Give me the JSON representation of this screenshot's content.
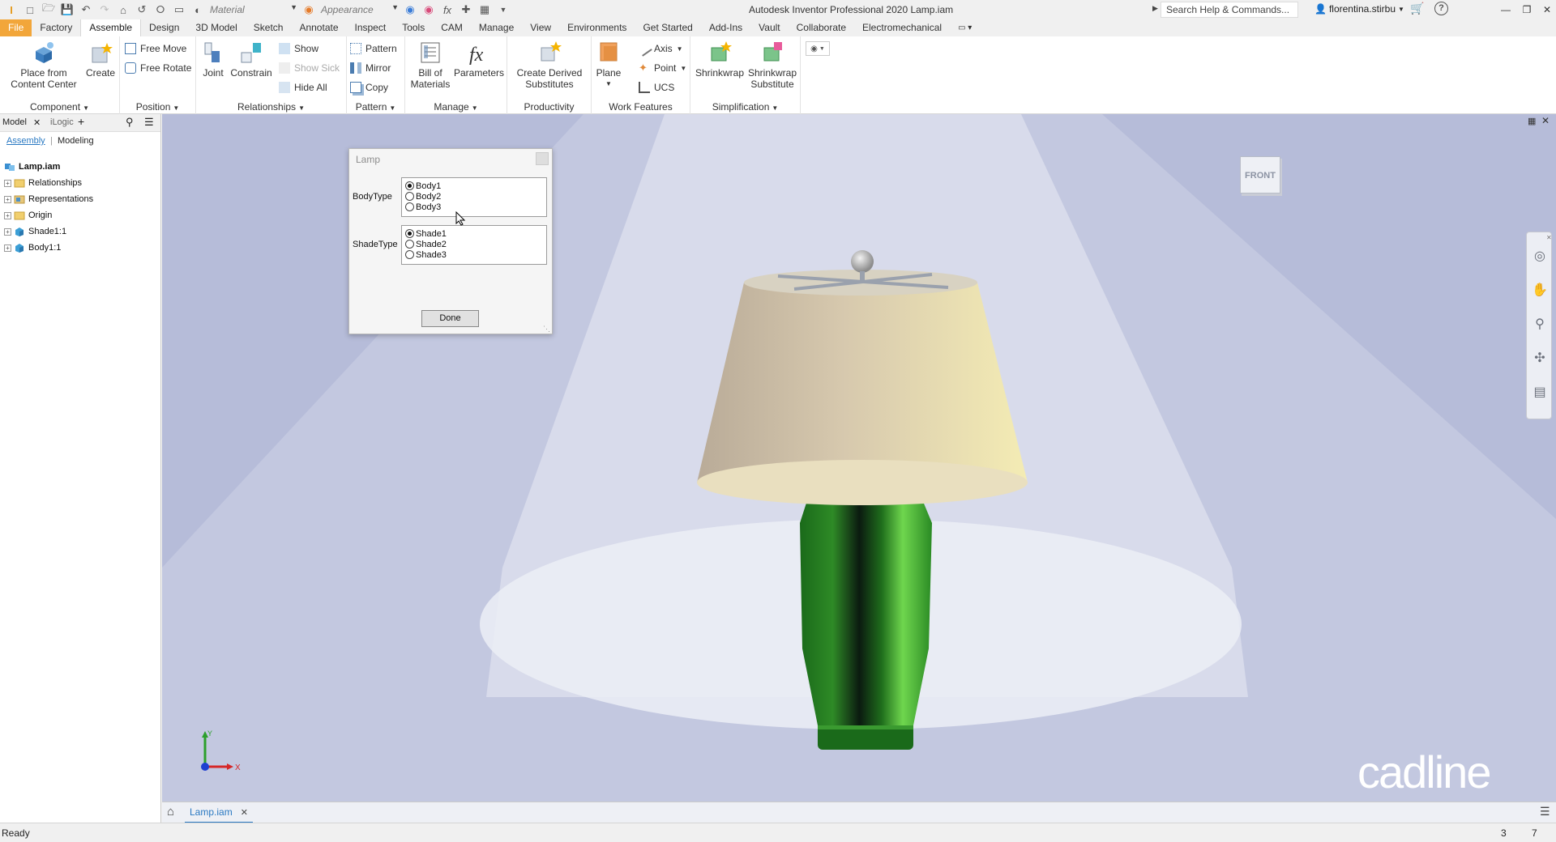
{
  "app": {
    "title": "Autodesk Inventor Professional 2020   Lamp.iam",
    "material_placeholder": "Material",
    "appearance_placeholder": "Appearance",
    "search_placeholder": "Search Help & Commands...",
    "user": "florentina.stirbu",
    "accent_color": "#f2a63a"
  },
  "menu": [
    "File",
    "Factory",
    "Assemble",
    "Design",
    "3D Model",
    "Sketch",
    "Annotate",
    "Inspect",
    "Tools",
    "CAM",
    "Manage",
    "View",
    "Environments",
    "Get Started",
    "Add-Ins",
    "Vault",
    "Collaborate",
    "Electromechanical"
  ],
  "ribbon": {
    "component": {
      "title": "Component",
      "place": "Place from\nContent Center",
      "create": "Create"
    },
    "position": {
      "title": "Position",
      "free_move": "Free Move",
      "free_rotate": "Free Rotate"
    },
    "relationships": {
      "title": "Relationships",
      "joint": "Joint",
      "constrain": "Constrain",
      "show": "Show",
      "show_sick": "Show Sick",
      "hide_all": "Hide All"
    },
    "pattern": {
      "title": "Pattern",
      "pattern": "Pattern",
      "mirror": "Mirror",
      "copy": "Copy"
    },
    "manage": {
      "title": "Manage",
      "bom": "Bill of\nMaterials",
      "parameters": "Parameters"
    },
    "productivity": {
      "title": "Productivity",
      "derived": "Create Derived\nSubstitutes"
    },
    "work_features": {
      "title": "Work Features",
      "plane": "Plane",
      "axis": "Axis",
      "point": "Point",
      "ucs": "UCS"
    },
    "simplification": {
      "title": "Simplification",
      "shrinkwrap": "Shrinkwrap",
      "shrinkwrap_sub": "Shrinkwrap\nSubstitute"
    }
  },
  "browser": {
    "tabs": {
      "model": "Model",
      "ilogic": "iLogic"
    },
    "sub": {
      "assembly": "Assembly",
      "modeling": "Modeling"
    },
    "root": "Lamp.iam",
    "items": [
      "Relationships",
      "Representations",
      "Origin",
      "Shade1:1",
      "Body1:1"
    ]
  },
  "dialog": {
    "title": "Lamp",
    "body_label": "BodyType",
    "body_options": [
      "Body1",
      "Body2",
      "Body3"
    ],
    "body_selected": "Body1",
    "shade_label": "ShadeType",
    "shade_options": [
      "Shade1",
      "Shade2",
      "Shade3"
    ],
    "shade_selected": "Shade1",
    "done": "Done"
  },
  "viewcube": {
    "face": "FRONT"
  },
  "triad": {
    "x": "X",
    "y": "Y"
  },
  "watermark": "cadline",
  "doc_tab": "Lamp.iam",
  "status": {
    "text": "Ready",
    "n1": "3",
    "n2": "7"
  }
}
